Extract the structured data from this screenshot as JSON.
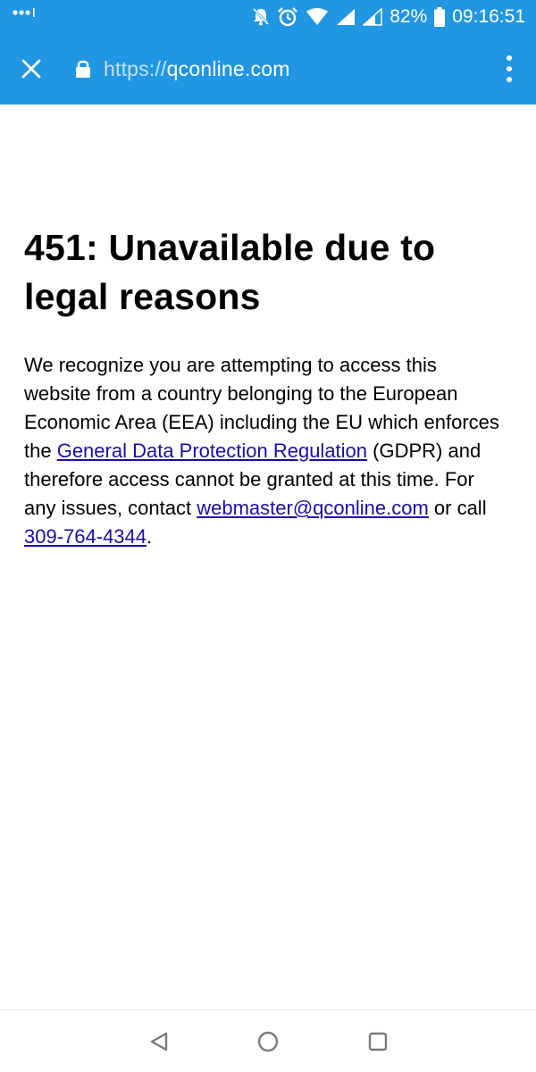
{
  "status_bar": {
    "battery_percent": "82%",
    "time": "09:16:51",
    "icons": [
      "signal-dots-icon",
      "notifications-off-icon",
      "alarm-icon",
      "wifi-icon",
      "cell-signal-icon",
      "cell-signal-icon",
      "battery-icon"
    ]
  },
  "toolbar": {
    "url_scheme": "https://",
    "url_host": "qconline.com",
    "icons": [
      "close-icon",
      "lock-icon",
      "overflow-menu-icon"
    ]
  },
  "page": {
    "heading": "451: Unavailable due to legal reasons",
    "body_text_1": "We recognize you are attempting to access this website from a country belonging to the European Economic Area (EEA) including the EU which enforces the ",
    "gdpr_link": "General Data Protection Regulation",
    "body_text_2": " (GDPR) and therefore access cannot be granted at this time. For any issues, contact ",
    "email_link": "webmaster@qconline.com",
    "body_text_3": " or call ",
    "phone_link": "309-764-4344",
    "body_text_4": "."
  },
  "nav_bar": {
    "icons": [
      "back-icon",
      "home-icon",
      "recents-icon"
    ]
  },
  "colors": {
    "accent": "#2196e3",
    "link": "#1a0dab"
  }
}
